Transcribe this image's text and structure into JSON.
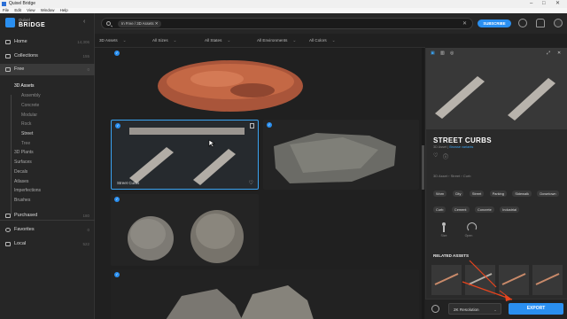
{
  "window": {
    "title": "Quixel Bridge"
  },
  "menu": [
    "File",
    "Edit",
    "View",
    "Window",
    "Help"
  ],
  "sidebar": {
    "logo_top": "Quixel",
    "logo_bottom": "BRIDGE",
    "items": [
      {
        "label": "Home",
        "count": "14,306"
      },
      {
        "label": "Collections",
        "count": "155"
      },
      {
        "label": "Free",
        "count": "0"
      }
    ],
    "free_children": [
      "3D Assets",
      "Assembly",
      "Concrete",
      "Modular",
      "Rock",
      "Street",
      "Tree"
    ],
    "free_more": [
      "3D Plants",
      "Surfaces",
      "Decals",
      "Atlases",
      "Imperfections",
      "Brushes"
    ],
    "bottom_items": [
      {
        "label": "Purchased",
        "count": "180"
      },
      {
        "label": "Favorites",
        "count": "0"
      },
      {
        "label": "Local",
        "count": "522"
      }
    ]
  },
  "search": {
    "chip": "In Free / 3D Assets",
    "subscribe": "SUBSCRIBE"
  },
  "filters": [
    "3D Assets",
    "All Sizes",
    "All States",
    "All Environments",
    "All Colors"
  ],
  "grid": {
    "selected_label": "Street Curbs"
  },
  "panel": {
    "title": "STREET CURBS",
    "sub_type": "3D Asset",
    "sub_link": "Browse variants",
    "breadcrumb": [
      "3D Asset",
      "Street",
      "Curb"
    ],
    "tags": [
      "Worn",
      "City",
      "Street",
      "Parking",
      "Sidewalk",
      "Downtown",
      "Curb",
      "Cement",
      "Concrete",
      "Industrial"
    ],
    "meta": [
      "Size",
      "Open"
    ],
    "related_label": "RELATED ASSETS",
    "resolution": "2K Resolution",
    "export_label": "EXPORT"
  },
  "colors": {
    "accent": "#2a8ff0",
    "arrow": "#e8441d"
  }
}
